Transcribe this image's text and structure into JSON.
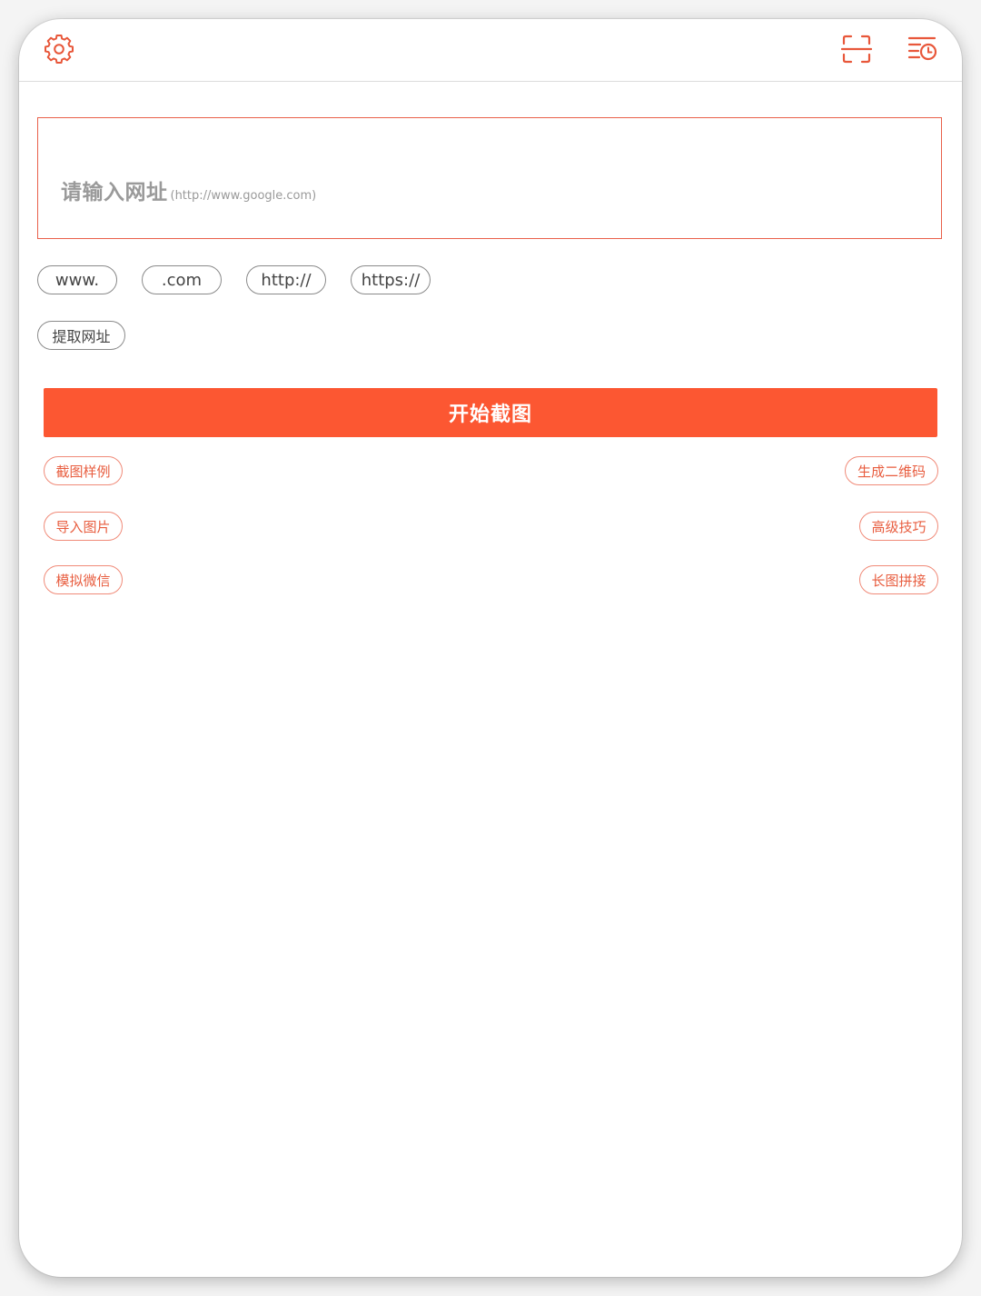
{
  "colors": {
    "accent": "#fc5732",
    "accent_text": "#e85d3f",
    "chip_border": "#8a8a8a",
    "placeholder": "#9a9a9a"
  },
  "toolbar": {
    "settings_icon": "gear-icon",
    "scan_icon": "scan-frame-icon",
    "history_icon": "history-list-icon"
  },
  "url_input": {
    "placeholder_main": "请输入网址",
    "placeholder_hint": "(http://www.google.com)"
  },
  "quick_inserts": [
    "www.",
    ".com",
    "http://",
    "https://"
  ],
  "extract_label": "提取网址",
  "start_label": "开始截图",
  "actions": {
    "left": [
      "截图样例",
      "导入图片",
      "模拟微信"
    ],
    "right": [
      "生成二维码",
      "高级技巧",
      "长图拼接"
    ]
  }
}
